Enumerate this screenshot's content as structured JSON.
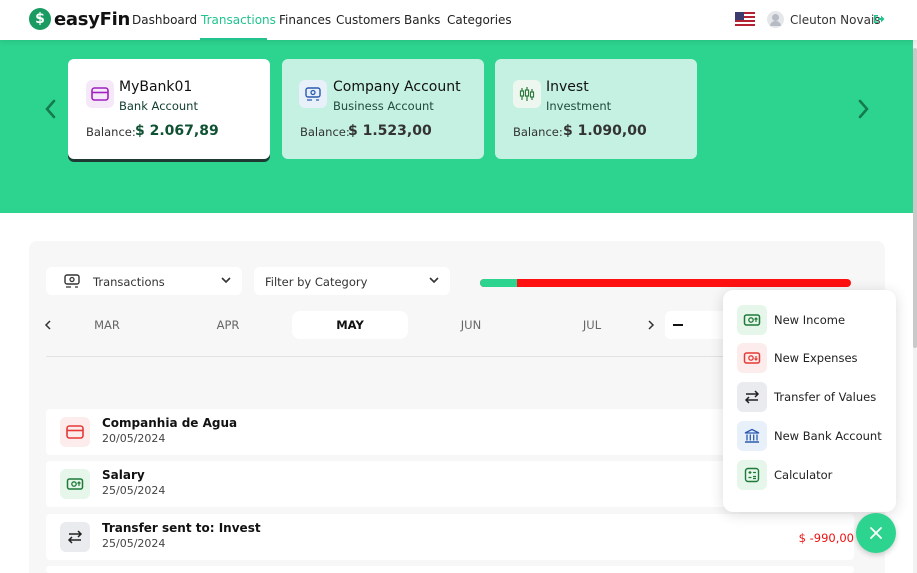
{
  "app": {
    "logo_letter": "$",
    "name": "easyFin"
  },
  "nav": {
    "items": [
      {
        "label": "Dashboard",
        "active": false
      },
      {
        "label": "Transactions",
        "active": true
      },
      {
        "label": "Finances",
        "active": false
      },
      {
        "label": "Customers",
        "active": false
      },
      {
        "label": "Banks",
        "active": false
      },
      {
        "label": "Categories",
        "active": false
      }
    ],
    "language_icon": "us-flag-icon",
    "user_name": "Cleuton Novais"
  },
  "accounts": [
    {
      "name": "MyBank01",
      "type": "Bank Account",
      "balance_label": "Balance:",
      "balance": "$ 2.067,89",
      "selected": true,
      "icon": "credit-card-icon"
    },
    {
      "name": "Company Account",
      "type": "Business Account",
      "balance_label": "Balance:",
      "balance": "$ 1.523,00",
      "selected": false,
      "icon": "money-cycle-icon"
    },
    {
      "name": "Invest",
      "type": "Investment",
      "balance_label": "Balance:",
      "balance": "$ 1.090,00",
      "selected": false,
      "icon": "candlestick-icon"
    }
  ],
  "filters": {
    "type_select": "Transactions",
    "category_select": "Filter by Category"
  },
  "budget_progress": {
    "spent_fraction": 0.1,
    "colors": {
      "fill": "#2dd48f",
      "track": "#ff1111"
    }
  },
  "months": {
    "items": [
      "MAR",
      "APR",
      "MAY",
      "JUN",
      "JUL"
    ],
    "active": "MAY"
  },
  "transactions": [
    {
      "title": "Companhia de Agua",
      "date": "20/05/2024",
      "amount": "",
      "kind": "expense",
      "icon": "card-expense-icon"
    },
    {
      "title": "Salary",
      "date": "25/05/2024",
      "amount": "",
      "kind": "income",
      "icon": "cash-income-icon"
    },
    {
      "title": "Transfer sent to: Invest",
      "date": "25/05/2024",
      "amount": "$ -990,00",
      "kind": "transfer",
      "icon": "transfer-icon"
    }
  ],
  "quick_actions": {
    "items": [
      {
        "label": "New Income",
        "icon": "income-icon"
      },
      {
        "label": "New Expenses",
        "icon": "expense-icon"
      },
      {
        "label": "Transfer of Values",
        "icon": "transfer-icon"
      },
      {
        "label": "New Bank Account",
        "icon": "bank-icon"
      },
      {
        "label": "Calculator",
        "icon": "calculator-icon"
      }
    ],
    "close_icon": "close-icon"
  },
  "colors": {
    "accent": "#2dd48f",
    "accent_text": "#22c38e",
    "negative": "#e11111"
  }
}
